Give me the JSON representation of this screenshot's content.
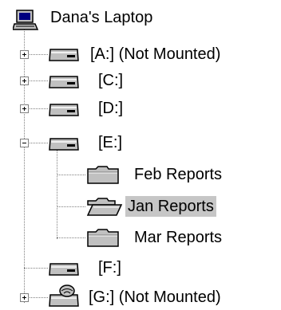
{
  "tree": {
    "root": {
      "label": "Dana's Laptop",
      "icon": "computer-icon"
    },
    "drives": [
      {
        "label": "[A:] (Not Mounted)",
        "expander": "plus",
        "icon": "drive-icon"
      },
      {
        "label": "[C:]",
        "expander": "plus",
        "icon": "drive-icon"
      },
      {
        "label": "[D:]",
        "expander": "plus",
        "icon": "drive-icon"
      },
      {
        "label": "[E:]",
        "expander": "minus",
        "icon": "drive-icon"
      },
      {
        "label": "[F:]",
        "expander": "none",
        "icon": "drive-icon"
      },
      {
        "label": "[G:] (Not Mounted)",
        "expander": "plus",
        "icon": "network-drive-icon"
      }
    ],
    "e_folders": [
      {
        "label": "Feb Reports",
        "icon": "folder-icon"
      },
      {
        "label": "Jan Reports",
        "icon": "folder-open-icon",
        "selected": true
      },
      {
        "label": "Mar Reports",
        "icon": "folder-icon"
      }
    ]
  },
  "colors": {
    "selection": "#c6c6c6",
    "tree_lines": "#808080"
  }
}
